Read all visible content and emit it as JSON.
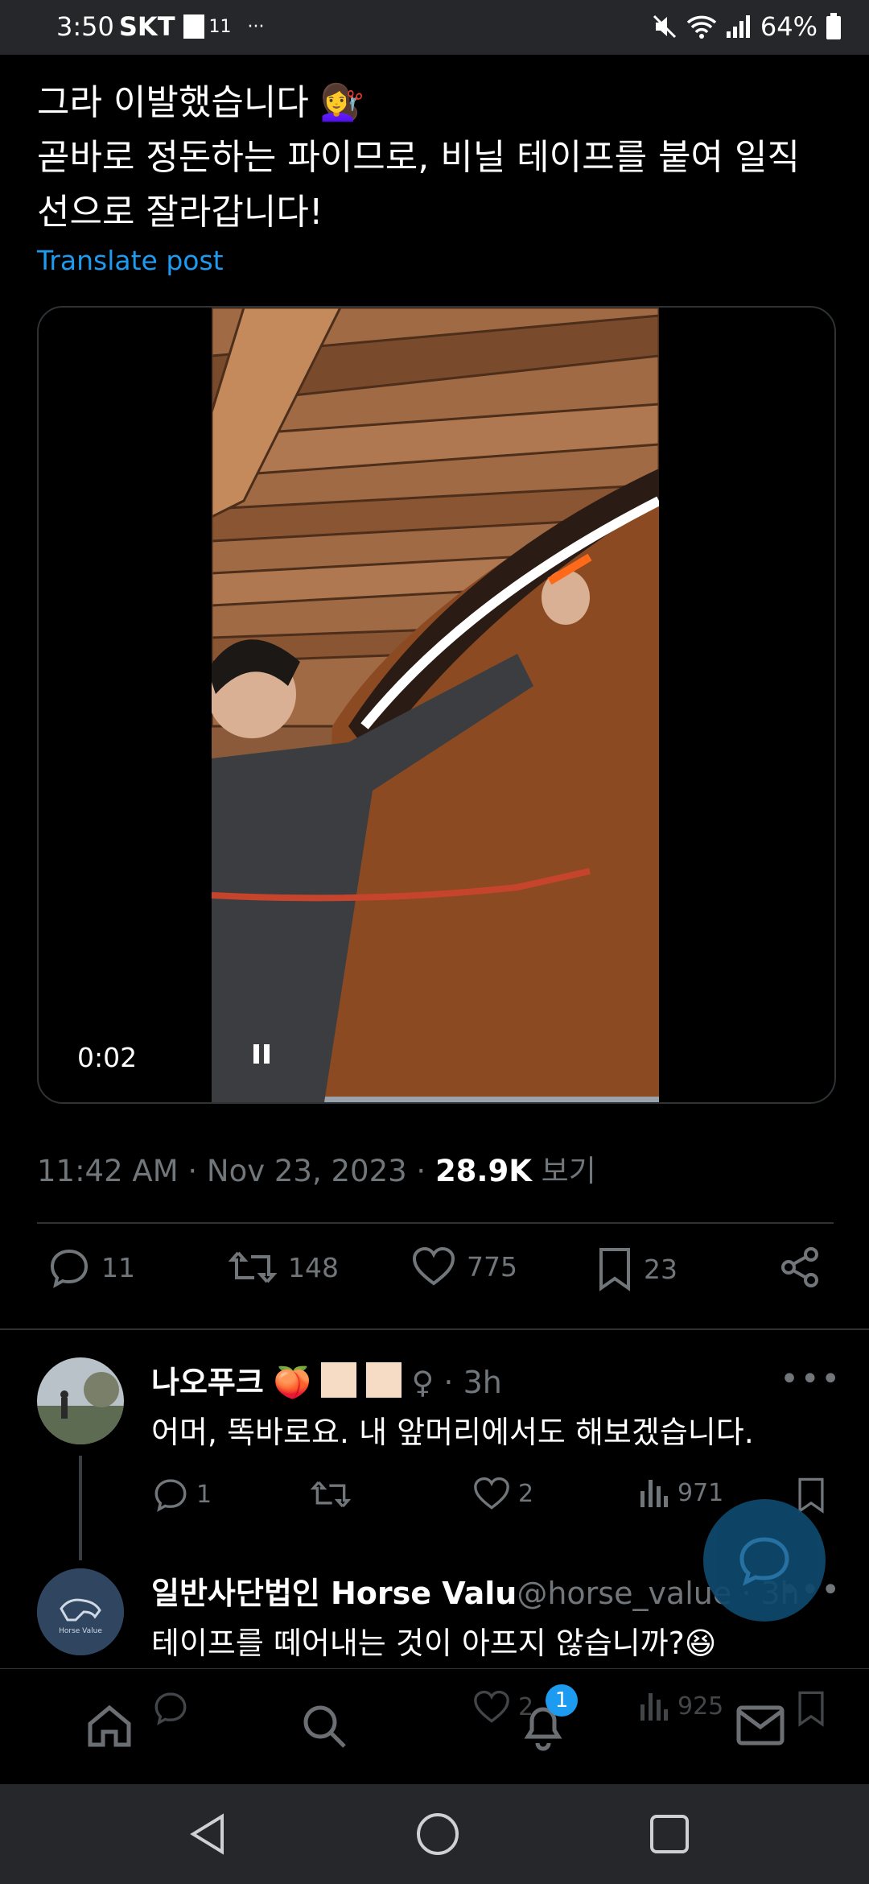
{
  "status_bar": {
    "time": "3:50",
    "carrier": "SKT",
    "extra": "11",
    "dots": "···",
    "battery": "64%"
  },
  "tweet": {
    "text_lines": [
      "그라 이발했습니다 💇‍♀️",
      "곧바로 정돈하는 파이므로, 비닐 테이프를 붙여 일직",
      "선으로 잘라갑니다!"
    ],
    "translate_label": "Translate post",
    "video_time": "0:02",
    "timestamp": "11:42 AM · Nov 23, 2023 · ",
    "views_count": "28.9K",
    "views_label": " 보기",
    "stats": {
      "replies": "11",
      "reposts": "148",
      "likes": "775",
      "bookmarks": "23"
    }
  },
  "replies": [
    {
      "name": "나오푸크",
      "name_decor": " 🍑 ",
      "handle": "♀ · 3h",
      "text": "어머, 똑바로요. 내 앞머리에서도 해보겠습니다.",
      "stats": {
        "replies": "1",
        "likes": "2",
        "views": "971"
      }
    },
    {
      "name": "일반사단법인 Horse Valu",
      "handle": "@horse_value · 3h",
      "avatar_text": "Horse Value",
      "text": "테이프를 떼어내는 것이 아프지 않습니까?😆",
      "stats": {
        "likes": "2",
        "views": "925"
      }
    }
  ],
  "bottom_nav": {
    "notifications_badge": "1"
  },
  "colors": {
    "accent": "#1d9bf0",
    "muted": "#71767b",
    "background": "#000000"
  }
}
